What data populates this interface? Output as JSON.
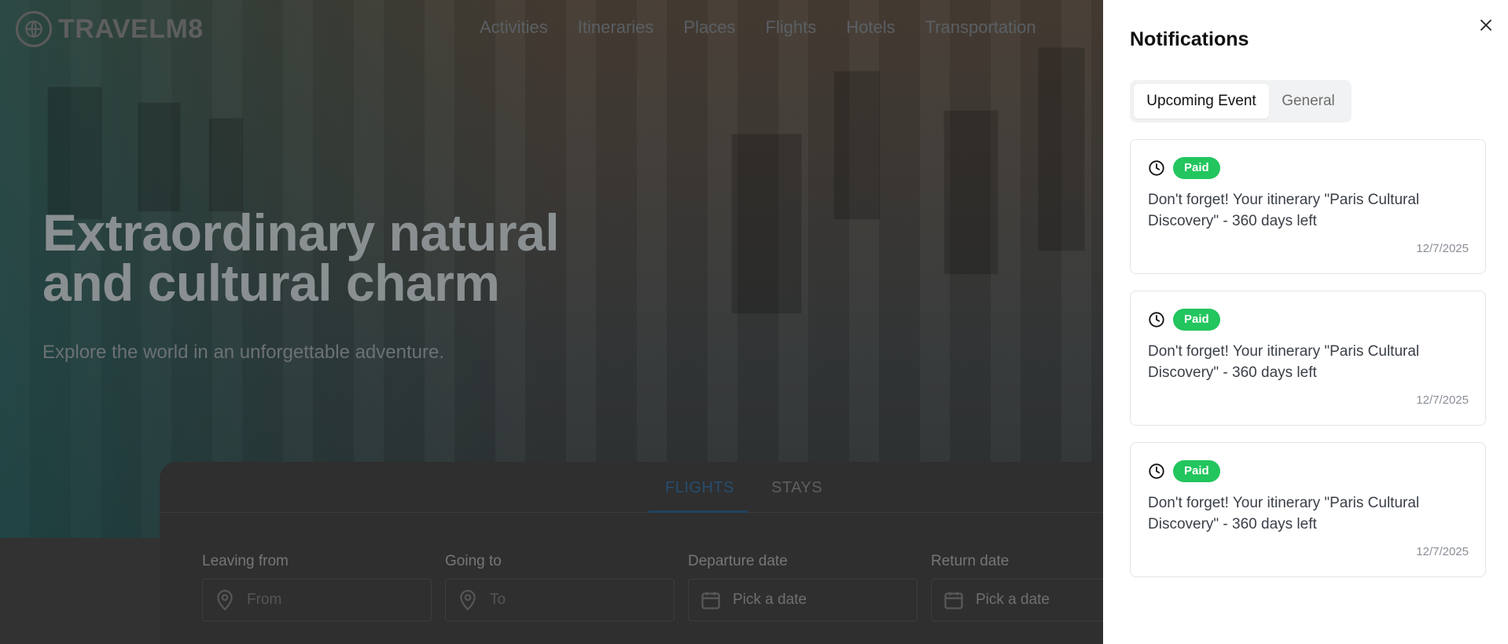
{
  "brand": {
    "name": "TRAVELM8"
  },
  "nav": {
    "items": [
      {
        "label": "Activities"
      },
      {
        "label": "Itineraries"
      },
      {
        "label": "Places"
      },
      {
        "label": "Flights"
      },
      {
        "label": "Hotels"
      },
      {
        "label": "Transportation"
      }
    ]
  },
  "hero": {
    "title": "Extraordinary natural and cultural charm",
    "subtitle": "Explore the world in an unforgettable adventure."
  },
  "search": {
    "tabs": [
      {
        "label": "FLIGHTS",
        "active": true
      },
      {
        "label": "STAYS",
        "active": false
      }
    ],
    "fields": [
      {
        "label": "Leaving from",
        "placeholder": "From",
        "icon": "map-pin-icon"
      },
      {
        "label": "Going to",
        "placeholder": "To",
        "icon": "map-pin-icon"
      },
      {
        "label": "Departure date",
        "value": "Pick a date",
        "icon": "calendar-icon"
      },
      {
        "label": "Return date",
        "value": "Pick a date",
        "icon": "calendar-icon"
      }
    ]
  },
  "notifications": {
    "title": "Notifications",
    "tabs": [
      {
        "label": "Upcoming Event",
        "active": true
      },
      {
        "label": "General",
        "active": false
      }
    ],
    "items": [
      {
        "badge": "Paid",
        "text": "Don't forget! Your itinerary \"Paris Cultural Discovery\" - 360 days left",
        "date": "12/7/2025"
      },
      {
        "badge": "Paid",
        "text": "Don't forget! Your itinerary \"Paris Cultural Discovery\" - 360 days left",
        "date": "12/7/2025"
      },
      {
        "badge": "Paid",
        "text": "Don't forget! Your itinerary \"Paris Cultural Discovery\" - 360 days left",
        "date": "12/7/2025"
      }
    ]
  },
  "colors": {
    "badge_paid": "#22c55e",
    "active_search_tab": "#1f4261",
    "overlay": "#2e2e2e"
  }
}
